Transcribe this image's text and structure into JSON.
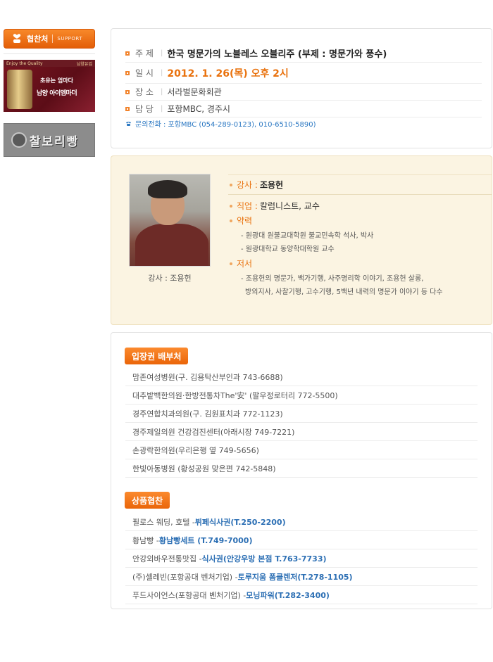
{
  "sidebar": {
    "support_label": "협찬처",
    "support_sub": "SUPPORT",
    "ad1": {
      "top_left": "Enjoy the Quality",
      "top_right": "남양유업",
      "line1": "초유는 엄마다",
      "line2": "남양 아이엠마더"
    },
    "ad2": {
      "text": "찰보리빵"
    }
  },
  "info": {
    "subject_key": "주 제",
    "subject_val": "한국 명문가의 노블레스 오블리주 (부제 : 명문가와 풍수)",
    "date_key": "일 시",
    "date_val": "2012. 1. 26(목) 오후 2시",
    "place_key": "장 소",
    "place_val": "서라벌문화회관",
    "manager_key": "담 당",
    "manager_val": "포항MBC, 경주시",
    "contact": "문의전화 : 포항MBC (054-289-0123), 010-6510-5890)"
  },
  "lecturer": {
    "caption": "강사 : 조용헌",
    "name_label": "강사 :",
    "name": "조용헌",
    "job_label": "직업 :",
    "job": "칼럼니스트, 교수",
    "career_label": "약력",
    "career": [
      "- 원광대 원불교대학원 불교민속학 석사, 박사",
      "- 원광대학교 동양학대학원 교수"
    ],
    "books_label": "저서",
    "books_line1": "- 조용헌의 명문가, 백가기행, 사주명리학 이야기, 조용헌 살롱,",
    "books_line2": "방외지사, 사찰기행, 고수기행, 5백년 내력의 명문가 이야기 등 다수"
  },
  "distribution": {
    "title": "입장권 배부처",
    "items": [
      "맘존여성병원(구. 김용탁산부인과 743-6688)",
      "대추밭백한의원·한방전통차The'安' (팔우정로터리 772-5500)",
      "경주연합치과의원(구. 김원표치과 772-1123)",
      "경주제일의원 건강검진센터(아래시장 749-7221)",
      "손광락한의원(우리은행 옆 749-5656)",
      "한빛아동병원 (황성공원 맞은편 742-5848)"
    ]
  },
  "sponsors": {
    "title": "상품협찬",
    "items": [
      {
        "text": "필로스 웨딩, 호텔 - ",
        "highlight": "뷔페식사권(T.250-2200)"
      },
      {
        "text": "황남빵 - ",
        "highlight": "황남빵세트 (T.749-7000)"
      },
      {
        "text": "안강외바우전통맛집 - ",
        "highlight": "식사권(안강우방 본점 T.763-7733)"
      },
      {
        "text": "(주)셀레빈(포항공대 벤처기업) - ",
        "highlight": "토루지움 폼클렌저(T.278-1105)"
      },
      {
        "text": "푸드사이언스(포항공대 벤처기업) - ",
        "highlight": "모닝파워(T.282-3400)"
      }
    ]
  },
  "colors": {
    "accent": "#ea6509",
    "link": "#2c6fb4",
    "lecturer_bg": "#fbf4e2"
  }
}
